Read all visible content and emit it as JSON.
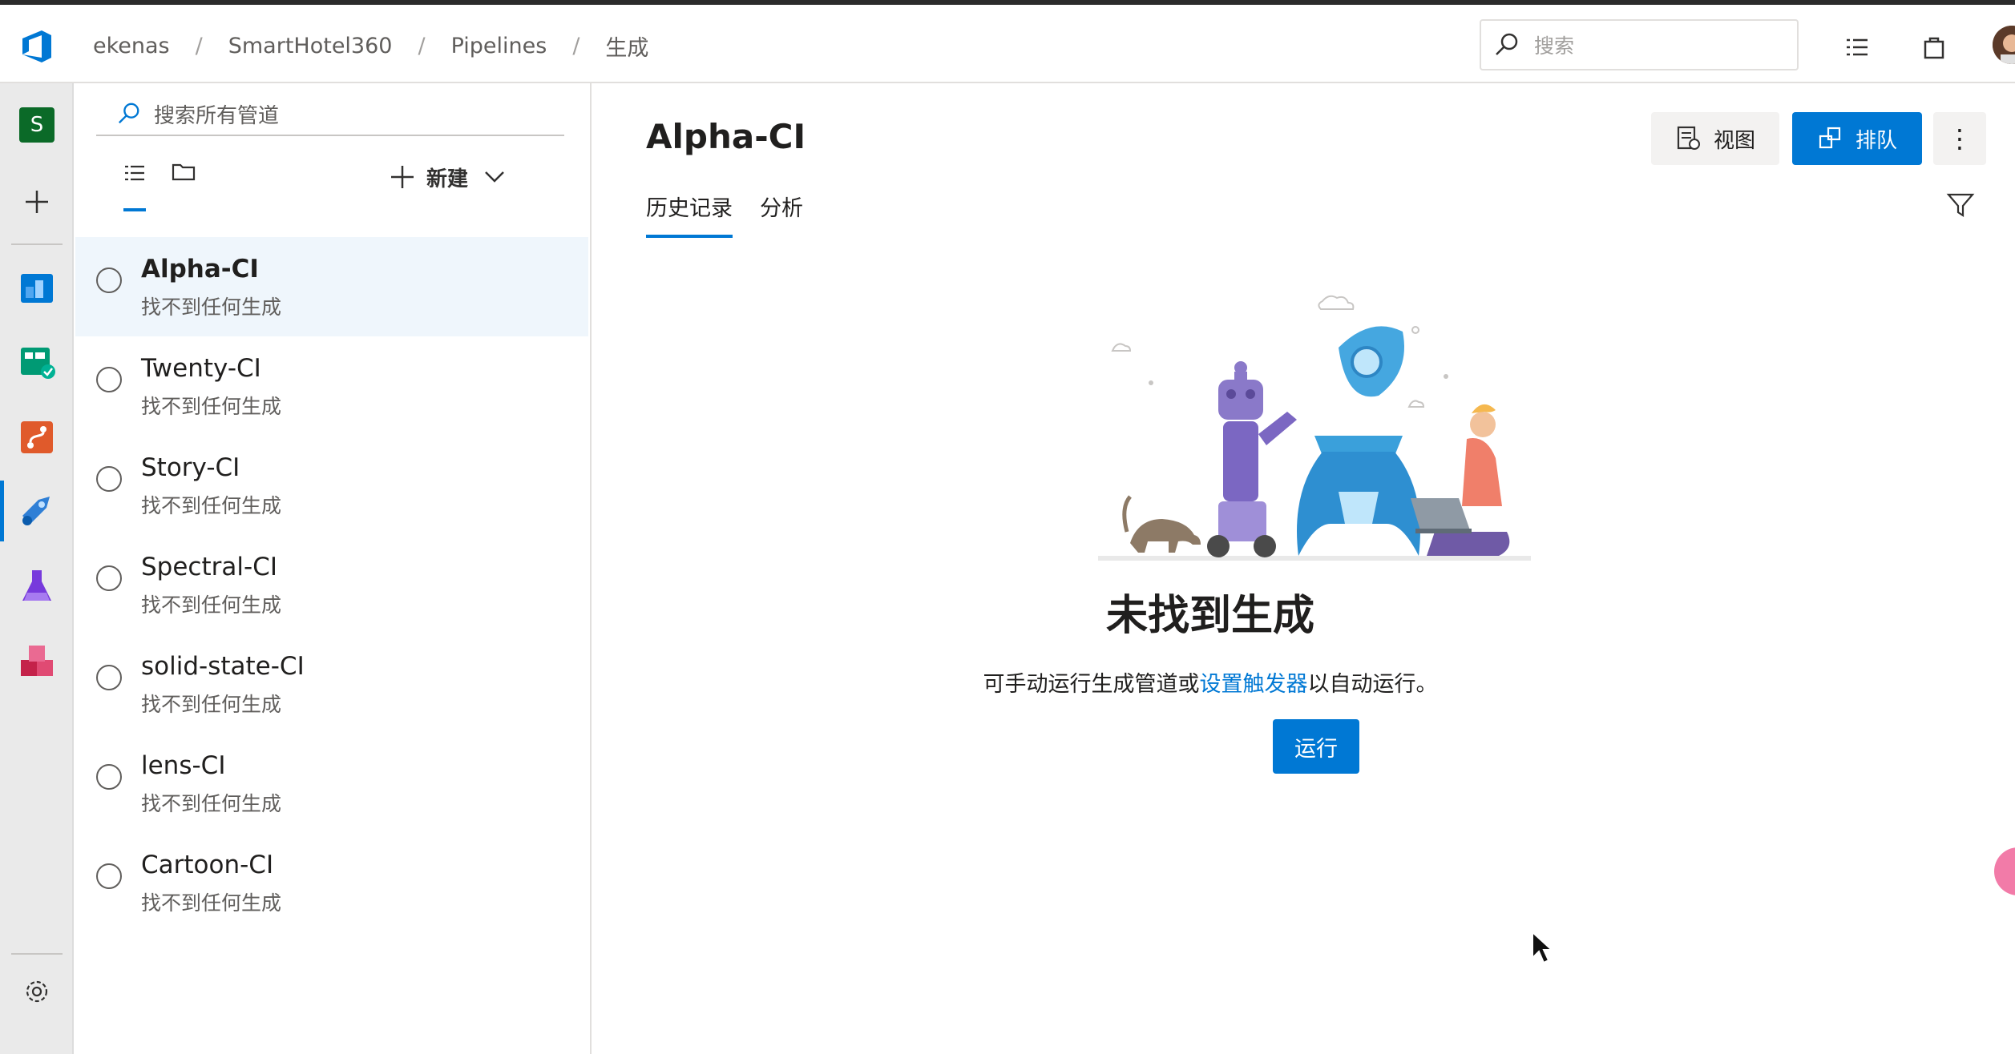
{
  "breadcrumb": [
    "ekenas",
    "SmartHotel360",
    "Pipelines",
    "生成"
  ],
  "top_search": {
    "placeholder": "搜索"
  },
  "rail": {
    "project_initial": "S"
  },
  "panel": {
    "search_placeholder": "搜索所有管道",
    "new_label": "新建",
    "pipelines": [
      {
        "name": "Alpha-CI",
        "status": "找不到任何生成"
      },
      {
        "name": "Twenty-CI",
        "status": "找不到任何生成"
      },
      {
        "name": "Story-CI",
        "status": "找不到任何生成"
      },
      {
        "name": "Spectral-CI",
        "status": "找不到任何生成"
      },
      {
        "name": "solid-state-CI",
        "status": "找不到任何生成"
      },
      {
        "name": "lens-CI",
        "status": "找不到任何生成"
      },
      {
        "name": "Cartoon-CI",
        "status": "找不到任何生成"
      }
    ]
  },
  "main": {
    "title": "Alpha-CI",
    "view_label": "视图",
    "queue_label": "排队",
    "more_label": "⋮",
    "tabs": [
      "历史记录",
      "分析"
    ],
    "empty": {
      "title": "未找到生成",
      "desc_before": "可手动运行生成管道或",
      "desc_link": "设置触发器",
      "desc_after": "以自动运行。",
      "run_label": "运行"
    }
  },
  "colors": {
    "accent": "#0078d4",
    "project_badge": "#0b6a28",
    "selected_row": "#eff6fc"
  }
}
